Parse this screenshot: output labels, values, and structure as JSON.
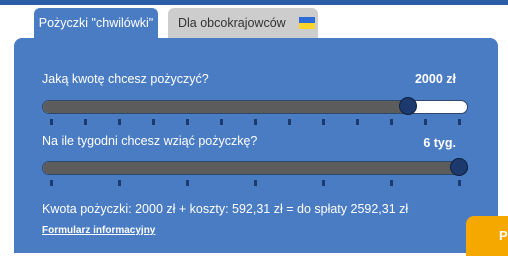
{
  "tabs": [
    {
      "label": "Pożyczki \"chwilówki\"",
      "active": true
    },
    {
      "label": "Dla obcokrajowców",
      "active": false,
      "flag_icon": "ukraine-flag-icon"
    }
  ],
  "amount_slider": {
    "question": "Jaką kwotę chcesz pożyczyć?",
    "value_label": "2000 zł",
    "fraction": 0.875,
    "tick_count": 12
  },
  "weeks_slider": {
    "question": "Na ile tygodni chcesz wziąć pożyczkę?",
    "value_label": "6 tyg.",
    "fraction": 1.0,
    "tick_count": 6
  },
  "summary": "Kwota pożyczki: 2000 zł + koszty: 592,31 zł = do spłaty 2592,31 zł",
  "info_link": "Formularz informacyjny",
  "cta_label": "P",
  "colors": {
    "panel": "#4a7cc3",
    "slider_fill": "#5c5c5c",
    "knob": "#1d3a6e",
    "cta": "#f5a800",
    "inactive_tab": "#cdcdcd"
  }
}
